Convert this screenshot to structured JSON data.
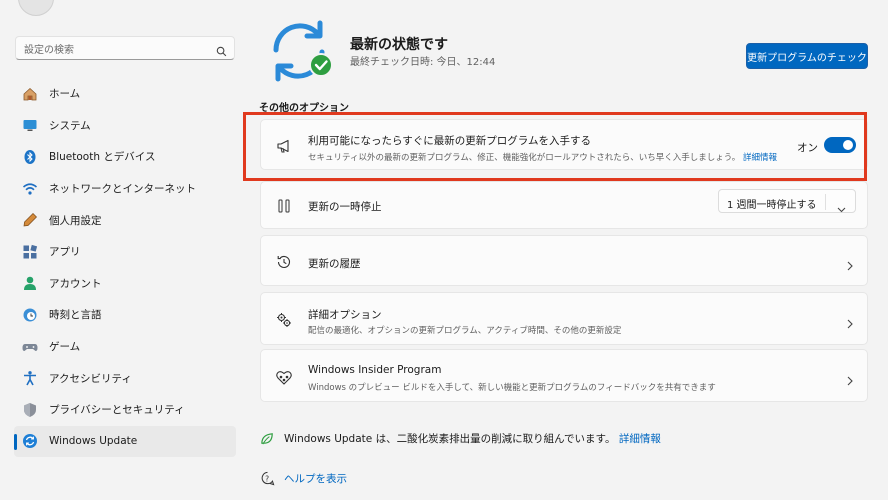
{
  "search": {
    "placeholder": "設定の検索"
  },
  "sidebar": {
    "items": [
      {
        "label": "ホーム",
        "icon": "home-icon"
      },
      {
        "label": "システム",
        "icon": "system-icon"
      },
      {
        "label": "Bluetooth とデバイス",
        "icon": "bluetooth-icon"
      },
      {
        "label": "ネットワークとインターネット",
        "icon": "wifi-icon"
      },
      {
        "label": "個人用設定",
        "icon": "pen-icon"
      },
      {
        "label": "アプリ",
        "icon": "apps-icon"
      },
      {
        "label": "アカウント",
        "icon": "account-icon"
      },
      {
        "label": "時刻と言語",
        "icon": "globe-clock-icon"
      },
      {
        "label": "ゲーム",
        "icon": "gamepad-icon"
      },
      {
        "label": "アクセシビリティ",
        "icon": "accessibility-icon"
      },
      {
        "label": "プライバシーとセキュリティ",
        "icon": "shield-icon"
      },
      {
        "label": "Windows Update",
        "icon": "windows-update-icon"
      }
    ],
    "active_index": 11
  },
  "status": {
    "title": "最新の状態です",
    "subtitle": "最終チェック日時: 今日、12:44",
    "check_button": "更新プログラムのチェック"
  },
  "options": {
    "section_title": "その他のオプション",
    "latest_updates": {
      "title": "利用可能になったらすぐに最新の更新プログラムを入手する",
      "desc": "セキュリティ以外の最新の更新プログラム、修正、機能強化がロールアウトされたら、いち早く入手しましょう。",
      "link": "詳細情報",
      "toggle_label": "オン",
      "toggle_on": true
    },
    "pause": {
      "title": "更新の一時停止",
      "select_value": "1 週間一時停止する"
    },
    "history": {
      "title": "更新の履歴"
    },
    "advanced": {
      "title": "詳細オプション",
      "desc": "配信の最適化、オプションの更新プログラム、アクティブ時間、その他の更新設定"
    },
    "insider": {
      "title": "Windows Insider Program",
      "desc": "Windows のプレビュー ビルドを入手して、新しい機能と更新プログラムのフィードバックを共有できます"
    }
  },
  "footer": {
    "carbon_text": "Windows Update は、二酸化炭素排出量の削減に取り組んでいます。",
    "carbon_link": "詳細情報",
    "help": "ヘルプを表示"
  },
  "colors": {
    "accent": "#0067c0",
    "highlight_box": "#e0391e",
    "success": "#2e9e40"
  }
}
